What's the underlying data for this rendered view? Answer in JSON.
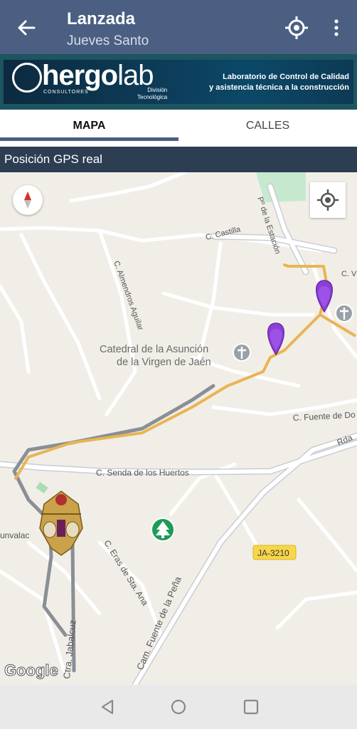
{
  "appbar": {
    "title": "Lanzada",
    "subtitle": "Jueves Santo",
    "back_icon": "arrow-back-icon",
    "locate_icon": "crosshair-icon",
    "more_icon": "more-vert-icon"
  },
  "banner": {
    "brand_left": "hergo",
    "brand_right": "lab",
    "consultores": "CONSULTORES",
    "division_line1": "División",
    "division_line2": "Tecnológica",
    "tagline_line1": "Laboratorio de Control de Calidad",
    "tagline_line2": "y asistencia técnica a la construcción"
  },
  "tabs": [
    {
      "label": "MAPA",
      "active": true
    },
    {
      "label": "CALLES",
      "active": false
    }
  ],
  "gps_label": "Posición GPS real",
  "map": {
    "labels": {
      "castilla": "C. Castilla",
      "estacion": "Pº de la Estación",
      "almendros": "C. Almendros Aguilar",
      "cathedral_1": "Catedral de la Asunción",
      "cathedral_2": "de la Virgen de Jaén",
      "fuente_de": "C. Fuente de Do",
      "rda": "Rda",
      "senda": "C. Senda de los Huertos",
      "eras": "C. Eras de Sta. Ana",
      "unvala": "unvalac",
      "road_code": "JA-3210",
      "fuente_pena": "Cam. Fuente de la Peña",
      "jabalcuz": "Ctra. Jabalcuz",
      "cv": "C. V"
    },
    "attribution": "Google",
    "colors": {
      "route_orange": "#e9b552",
      "route_gray": "#8a8f96",
      "marker_purple": "#8a3fd6",
      "park_green": "#c6e8cf"
    }
  },
  "navbar": {
    "back": "nav-back-icon",
    "home": "nav-home-icon",
    "recents": "nav-recents-icon"
  }
}
